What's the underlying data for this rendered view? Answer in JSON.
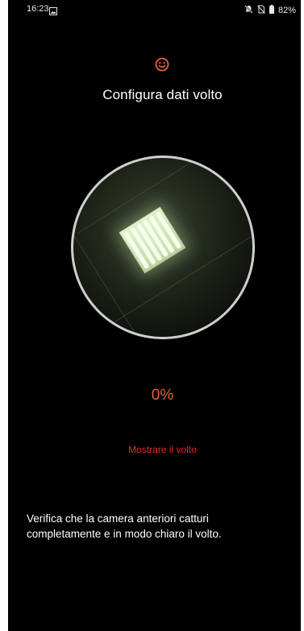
{
  "status_bar": {
    "time": "16:23",
    "battery_percent": "82%",
    "icons": [
      "gallery-icon",
      "notifications-muted-icon",
      "no-sim-icon",
      "battery-icon"
    ]
  },
  "header": {
    "icon": "smiley-face-icon",
    "title": "Configura dati volto"
  },
  "camera": {
    "progress": "0%"
  },
  "hint": "Mostrare il volto",
  "instruction": "Verifica che la camera anteriori catturi completamente e in modo chiaro il volto.",
  "colors": {
    "background": "#000000",
    "accent_orange": "#e5643c",
    "hint_red": "#e02b25",
    "ring": "#cfcfcf"
  }
}
